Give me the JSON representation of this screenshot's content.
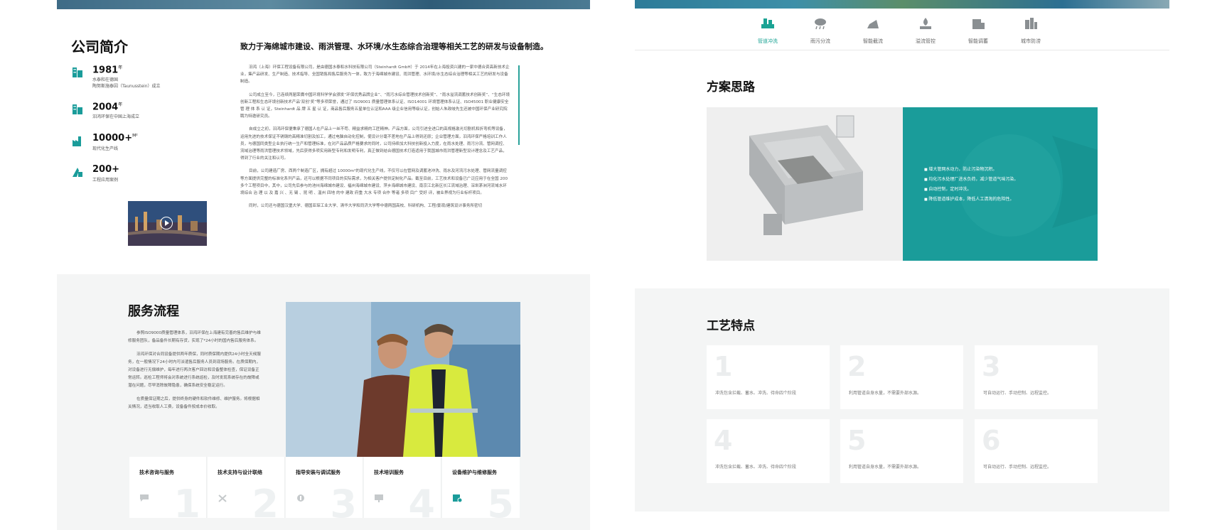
{
  "intro": {
    "title": "公司简介",
    "heading": "致力于海绵城市建设、雨洪管理、水环境/水生态综合治理等相关工艺的研发与设备制造。",
    "stats": [
      {
        "icon": "building-icon",
        "num": "1981",
        "unit": "年",
        "desc": "水泰和在德国\n陶努斯施泰因（Taunusstein）成立"
      },
      {
        "icon": "building-icon",
        "num": "2004",
        "unit": "年",
        "desc": "汨鸿环保在中国上海成立"
      },
      {
        "icon": "factory-icon",
        "num": "10000+",
        "unit": "M²",
        "desc": "现代化生产线"
      },
      {
        "icon": "project-icon",
        "num": "200+",
        "unit": "",
        "desc": "工程应用案例"
      }
    ],
    "paragraphs": [
      "汨鸿（上海）环保工程设备有限公司，是由德国水泰和水科技有限公司（Steinhardt GmbH）于 2014年在上海投资兴建的一家中德合资高新技术企业，集产品研发、生产制造、技术指导、全国销售和售后服务为一体，致力于海绵城市建设、雨洪管理、水环境/水生态综合治理等相关工艺的研发与设备制造。",
      "公司成立至今，已连续两届荣膺中国环境科学学会颁发“环保优秀品牌企业”、“雨污水综合管理技术创新奖”、“雨水溢流调蓄技术创新奖”、“生态环境创新工程和生态环境创新技术产品‘双创’奖”等多项荣誉，通过了 ISO9001 质量管理体系认证、ISO14001 环境管理体系认证、ISO45001 职业健康安全 管 理 体 系 认 证，Steinhardt 品 牌 五 星 认 证，商品售后服务五星单位认证和AAA 级企业信用等级认证，创始人朱政岐先生还被中国环保产业研究院聘为特邀研究员。",
      "自成立之初，汨鸿环保便秉承了德国人在产品上一丝不苟、精益求精的工匠精神。产品方面，公司引进全进口的高规格激光切割机和折弯机等设备，运用先进的技术保证不锈钢的高精准切割及加工，通过电脑自动化控制，使设计分毫不差地在产品上得到还原；企业管理方面，汨鸿环保严格培训工作人员，与德国同类型企业执行统一生产和管理标准，在对产品品质严格要求的同时，公司持续加大科技创新投入力度，在雨水处理、雨污分流、管网调控、流域治理等雨洪管理技术领域，先后获得多项实用新型专利和发明专利，真正做到结合德国技术打造适用于我国城市雨洪管理新型设计理念及工艺产品，得到了行业的关注和认可。",
      "目前，公司建造厂房、西两个制造厂区，拥有超过 10000m²的现代化生产线，不仅可以在管网及调蓄池冲洗、雨水及河流污水处理、管网流量调控等方面提供完整的标准化系列产品，还可以根据不同项目的实际需求，为相关客户提供定制化产品。截至目前，工艺技术和设备已广泛应用于在全国 200 多个工程项目中，其中，公司先后参与的池州海绵城市建设、福州海绵城市建设、萍乡海绵城市建设、南京江北新区长江流域治理、深圳茅洲河流域水环境综合 治 理 以 及 嘉 兴 、无 锡 、昆 明 、温州 四地 的中 建政 府重 大水 专项 合作 等诸 多项 目广 受好 评，被业界视为行业标杆项目。",
      "同时，公司还与德国汉堡大学、德国亚琛工业大学、清华大学和同济大学等中德两国高校、科研机构、工程/景观/建筑设计事务所密切"
    ],
    "video_label": "play-icon"
  },
  "service": {
    "title": "服务流程",
    "paragraphs": [
      "参照ISO9000质量管理体系，汨鸿环保在上海建有完善的售后维护与维修服务团队，备品备件长期有存货，实现了*24小时的国内售后服务体系。",
      "汨鸿环保对合同设备提供两年质保，同时质保期内提供24小时全天候服务，在一般情况下24小时内可派遣售后服务人员到现场服务。在质保期内，对设备进行无偿维护，每年进行两次客户回访和设备整体检查，保证设备正常运转。巡检工程师将会对系统进行系统巡检，及时发现系统存在的故障或潜在问题，尽早消除故障隐患，确保系统安全稳定运行。",
      "在质量保证期之后，提供终身的硬件和软件维修、维护服务。将根据相关情况，适当收取人工费，设备备件按成本价收取。"
    ],
    "steps": [
      {
        "label": "技术咨询与服务",
        "num": "1",
        "icon": "chat-icon"
      },
      {
        "label": "技术支持与设计联络",
        "num": "2",
        "icon": "tools-icon"
      },
      {
        "label": "指导安装与调试服务",
        "num": "3",
        "icon": "wrench-icon"
      },
      {
        "label": "技术培训服务",
        "num": "4",
        "icon": "presentation-icon"
      },
      {
        "label": "设备维护与维修服务",
        "num": "5",
        "icon": "maintenance-icon"
      }
    ]
  },
  "nav": {
    "tabs": [
      {
        "label": "管道冲洗",
        "icon": "pipe-flush-icon",
        "active": true
      },
      {
        "label": "雨污分流",
        "icon": "rain-cloud-icon",
        "active": false
      },
      {
        "label": "智能截流",
        "icon": "interception-icon",
        "active": false
      },
      {
        "label": "溢流管控",
        "icon": "overflow-icon",
        "active": false
      },
      {
        "label": "智能调蓄",
        "icon": "storage-icon",
        "active": false
      },
      {
        "label": "城市防涝",
        "icon": "city-flood-icon",
        "active": false
      }
    ]
  },
  "plan": {
    "title": "方案思路",
    "points": [
      "增大管网水动力，防止污染物沉积。",
      "均化污水处理厂进水负荷，减少管道气味污染。",
      "自动控制，定时冲洗。",
      "降低管道维护成本，降低人工清淘的危险性。"
    ]
  },
  "craft": {
    "title": "工艺特点",
    "cards": [
      {
        "num": "1",
        "text": "冲洗包含拦截、蓄水、冲洗、待命四个阶段"
      },
      {
        "num": "2",
        "text": "利用管道自身水量，不需要外部水源。"
      },
      {
        "num": "3",
        "text": "可自动运行、手动控制、远程监控。"
      },
      {
        "num": "4",
        "text": "冲洗包含拦截、蓄水、冲洗、待命四个阶段"
      },
      {
        "num": "5",
        "text": "利用管道自身水量，不需要外部水源。"
      },
      {
        "num": "6",
        "text": "可自动运行、手动控制、远程监控。"
      }
    ]
  },
  "colors": {
    "accent": "#1a9c9a",
    "active_tab": "#1ba394",
    "icon": "#1a9c9a"
  }
}
